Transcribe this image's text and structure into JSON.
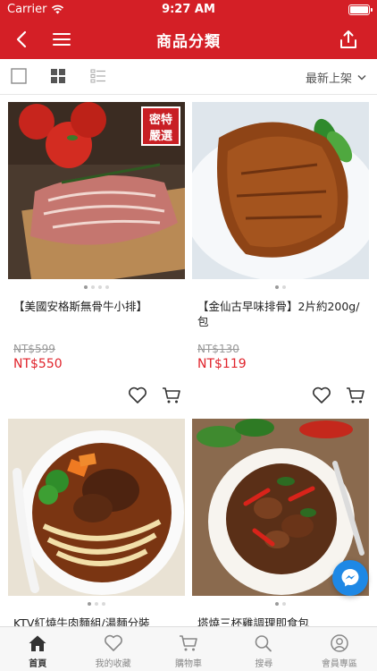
{
  "status_bar": {
    "carrier": "Carrier",
    "time": "9:27 AM"
  },
  "navbar": {
    "title": "商品分類"
  },
  "toolbar": {
    "sort_label": "最新上架"
  },
  "products": [
    {
      "name": "【美國安格斯無骨牛小排】",
      "original_price": "NT$599",
      "price": "NT$550",
      "badge": "密特嚴選",
      "image_dots": 4,
      "active_dot": 1
    },
    {
      "name": "【金仙古早味排骨】2片約200g/包",
      "original_price": "NT$130",
      "price": "NT$119",
      "image_dots": 2,
      "active_dot": 1
    },
    {
      "name": "KTV紅燒牛肉麵組/湯麵分裝",
      "image_dots": 3,
      "active_dot": 1
    },
    {
      "name": "塔燒三杯雞調理即食包",
      "image_dots": 2,
      "active_dot": 1
    }
  ],
  "tabbar": {
    "items": [
      {
        "label": "首頁",
        "icon": "home-icon",
        "active": true
      },
      {
        "label": "我的收藏",
        "icon": "heart-icon",
        "active": false
      },
      {
        "label": "購物車",
        "icon": "cart-icon",
        "active": false
      },
      {
        "label": "搜尋",
        "icon": "search-icon",
        "active": false
      },
      {
        "label": "會員專區",
        "icon": "user-icon",
        "active": false
      }
    ]
  },
  "colors": {
    "brand": "#d41f26",
    "price": "#e0232b",
    "messenger": "#1e88e5"
  }
}
